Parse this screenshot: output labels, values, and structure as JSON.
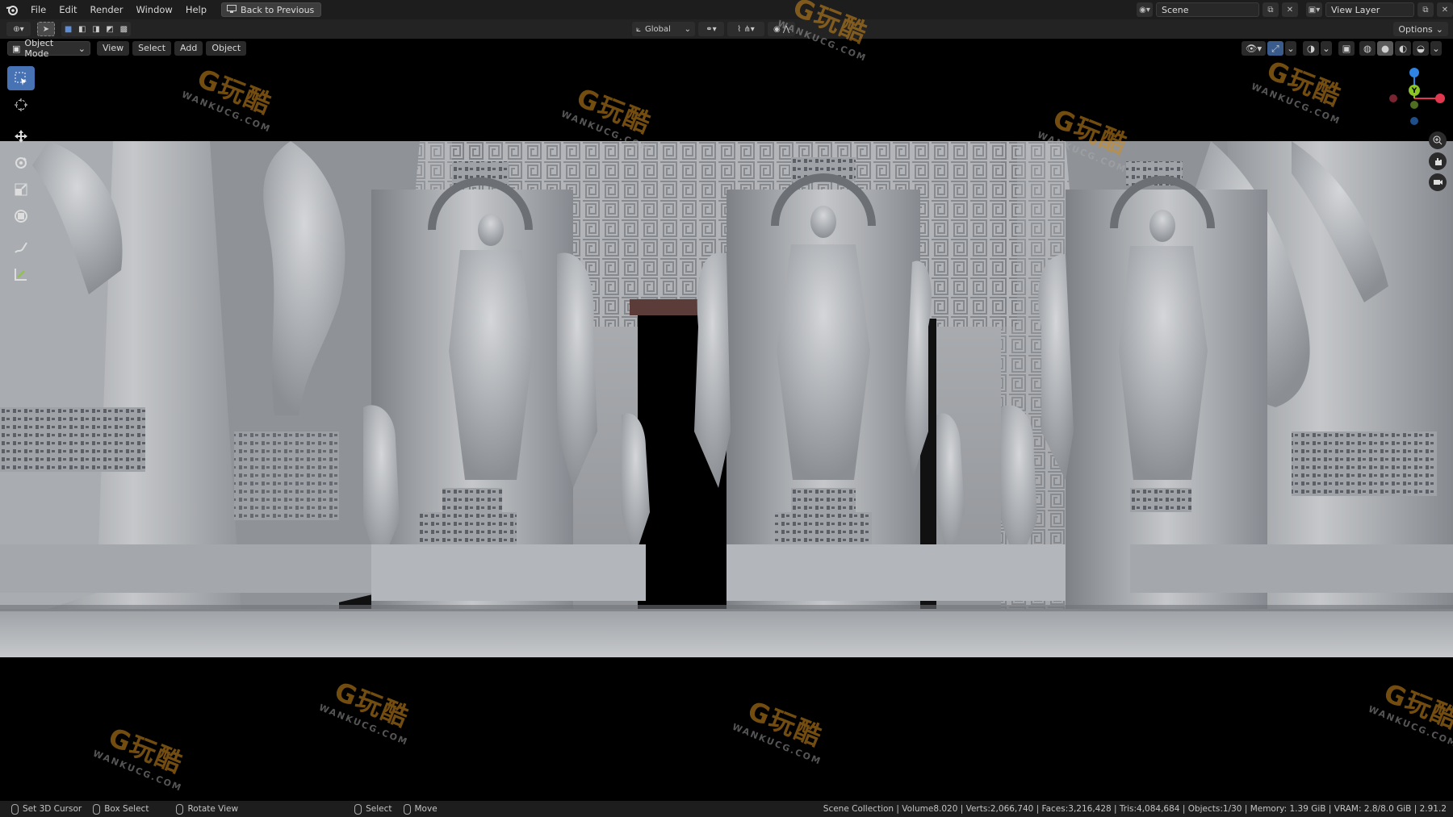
{
  "topbar": {
    "menus": [
      "File",
      "Edit",
      "Render",
      "Window",
      "Help"
    ],
    "back_button": "Back to Previous",
    "scene_name": "Scene",
    "view_layer": "View Layer"
  },
  "toolheader": {
    "orientation": "Global",
    "options": "Options"
  },
  "viewport_header": {
    "mode": "Object Mode",
    "menus": [
      "View",
      "Select",
      "Add",
      "Object"
    ]
  },
  "toolbar": {
    "tools": [
      "select-box",
      "cursor",
      "move",
      "rotate",
      "scale",
      "transform",
      "annotate",
      "measure"
    ],
    "active": "select-box"
  },
  "gizmo": {
    "x_label": "X",
    "y_label": "Y",
    "z_label": "Z",
    "colors": {
      "x": "#e2384f",
      "y": "#8bc522",
      "z": "#2f83e3"
    }
  },
  "watermark": {
    "text": "G玩酷",
    "subtext": "WANKUCG.COM"
  },
  "statusbar": {
    "set_cursor": "Set 3D Cursor",
    "box_select": "Box Select",
    "rotate_view": "Rotate View",
    "select": "Select",
    "move": "Move",
    "info": "Scene Collection | Volume8.020 | Verts:2,066,740 | Faces:3,216,428 | Tris:4,084,684 | Objects:1/30 | Memory: 1.39 GiB | VRAM: 2.8/8.0 GiB | 2.91.2"
  },
  "theme": {
    "accent": "#4772b3",
    "header_bg": "#1d1d1d"
  }
}
